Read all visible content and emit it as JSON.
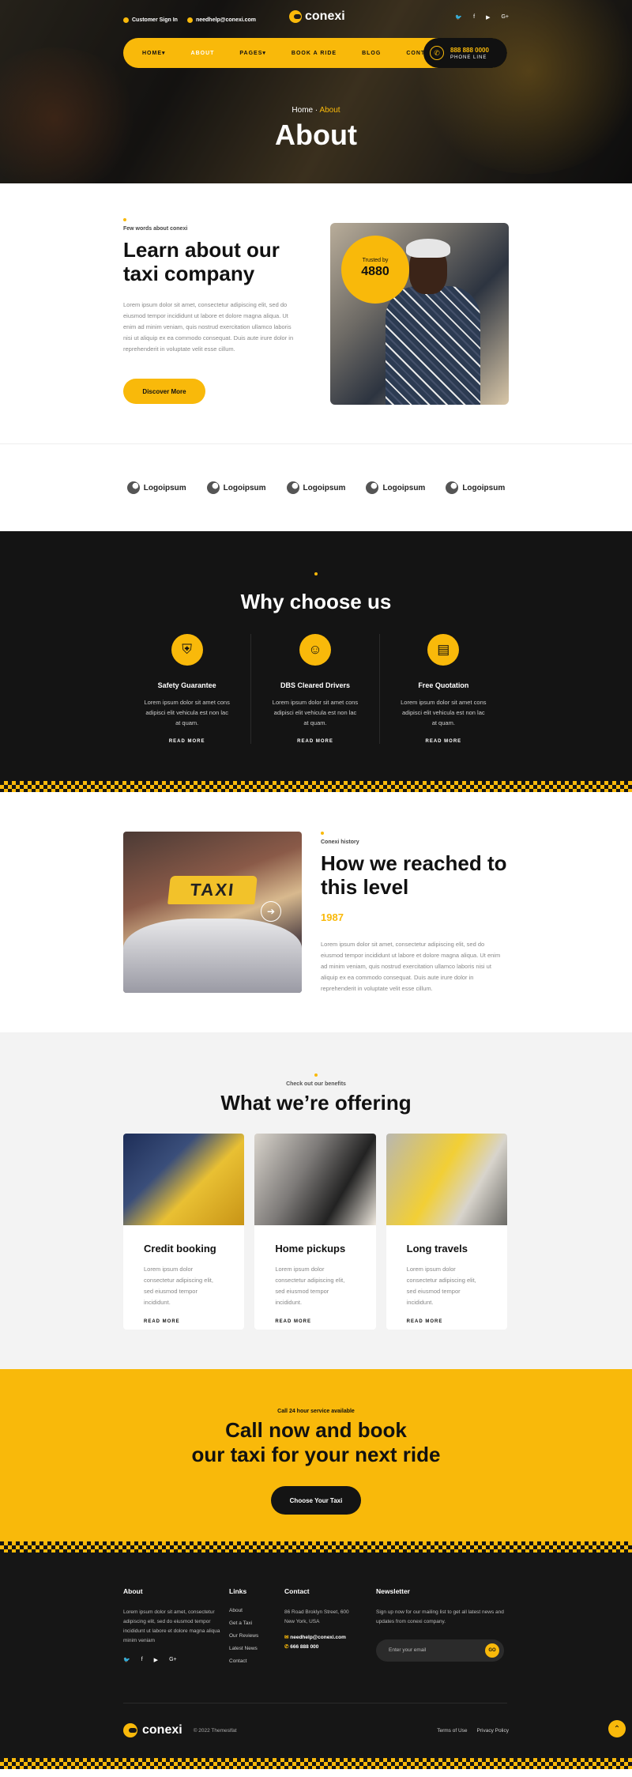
{
  "topbar": {
    "signin": "Customer Sign In",
    "email": "needhelp@conexi.com",
    "socials": [
      "twitter-icon",
      "facebook-icon",
      "youtube-icon",
      "google-plus-icon"
    ]
  },
  "brand": {
    "name": "conexi",
    "accent": "#f9b90a",
    "dark": "#141414"
  },
  "nav": {
    "items": [
      "HOME",
      "ABOUT",
      "PAGES",
      "BOOK A RIDE",
      "BLOG",
      "CONTACT"
    ],
    "phone": "888 888 0000",
    "phone_label": "PHONE LINE"
  },
  "hero": {
    "crumb_home": "Home",
    "crumb_current": "About",
    "title": "About"
  },
  "about": {
    "eyebrow": "Few words about conexi",
    "title": "Learn about our taxi company",
    "text": "Lorem ipsum dolor sit amet, consectetur adipiscing elit, sed do eiusmod tempor incididunt ut labore et dolore magna aliqua. Ut enim ad minim veniam, quis nostrud exercitation ullamco laboris nisi ut aliquip ex ea commodo consequat. Duis aute irure dolor in reprehenderit in voluptate velit esse cillum.",
    "button": "Discover More",
    "trusted_label": "Trusted by",
    "trusted_count": "4880"
  },
  "logos": [
    "Logoipsum",
    "Logoipsum",
    "Logoipsum",
    "Logoipsum",
    "Logoipsum"
  ],
  "why": {
    "title": "Why choose us",
    "features": [
      {
        "title": "Safety Guarantee",
        "text": "Lorem ipsum dolor sit amet cons adipisci elit vehicula est non lac at quam.",
        "link": "READ MORE",
        "icon": "shield-icon"
      },
      {
        "title": "DBS Cleared Drivers",
        "text": "Lorem ipsum dolor sit amet cons adipisci elit vehicula est non lac at quam.",
        "link": "READ MORE",
        "icon": "driver-icon"
      },
      {
        "title": "Free Quotation",
        "text": "Lorem ipsum dolor sit amet cons adipisci elit vehicula est non lac at quam.",
        "link": "READ MORE",
        "icon": "clipboard-icon"
      }
    ]
  },
  "history": {
    "eyebrow": "Conexi history",
    "title": "How we reached to this level",
    "year": "1987",
    "text": "Lorem ipsum dolor sit amet, consectetur adipiscing elit, sed do eiusmod tempor incididunt ut labore et dolore magna aliqua. Ut enim ad minim veniam, quis nostrud exercitation ullamco laboris nisi ut aliquip ex ea commodo consequat. Duis aute irure dolor in reprehenderit in voluptate velit esse cillum.",
    "sign_text": "TAXI"
  },
  "offer": {
    "eyebrow": "Check out our benefits",
    "title": "What we’re offering",
    "cards": [
      {
        "title": "Credit booking",
        "text": "Lorem ipsum dolor consectetur adipiscing elit, sed eiusmod tempor incididunt.",
        "link": "READ MORE"
      },
      {
        "title": "Home pickups",
        "text": "Lorem ipsum dolor consectetur adipiscing elit, sed eiusmod tempor incididunt.",
        "link": "READ MORE"
      },
      {
        "title": "Long travels",
        "text": "Lorem ipsum dolor consectetur adipiscing elit, sed eiusmod tempor incididunt.",
        "link": "READ MORE"
      }
    ]
  },
  "cta": {
    "eyebrow": "Call 24 hour service available",
    "line1": "Call now and book",
    "line2": "our taxi for your next ride",
    "button": "Choose Your Taxi"
  },
  "footer": {
    "about_title": "About",
    "about_text": "Lorem ipsum dolor sit amet, consectetur adipiscing elit, sed do eiusmod tempor incididunt ut labore et dolore magna aliqua minim veniam",
    "links_title": "Links",
    "links": [
      "About",
      "Get a Taxi",
      "Our Reviews",
      "Latest News",
      "Contact"
    ],
    "contact_title": "Contact",
    "address": "86 Road Broklyn Street, 600 New York, USA",
    "email": "needhelp@conexi.com",
    "phone": "666 888 000",
    "newsletter_title": "Newsletter",
    "newsletter_text": "Sign up now for our mailing list to get all latest news and updates from conexi company.",
    "email_placeholder": "Enter your email",
    "go": "GO",
    "copyright": "© 2022 Themeslfat",
    "bottom_links": [
      "Terms of Use",
      "Privacy Policy"
    ]
  }
}
